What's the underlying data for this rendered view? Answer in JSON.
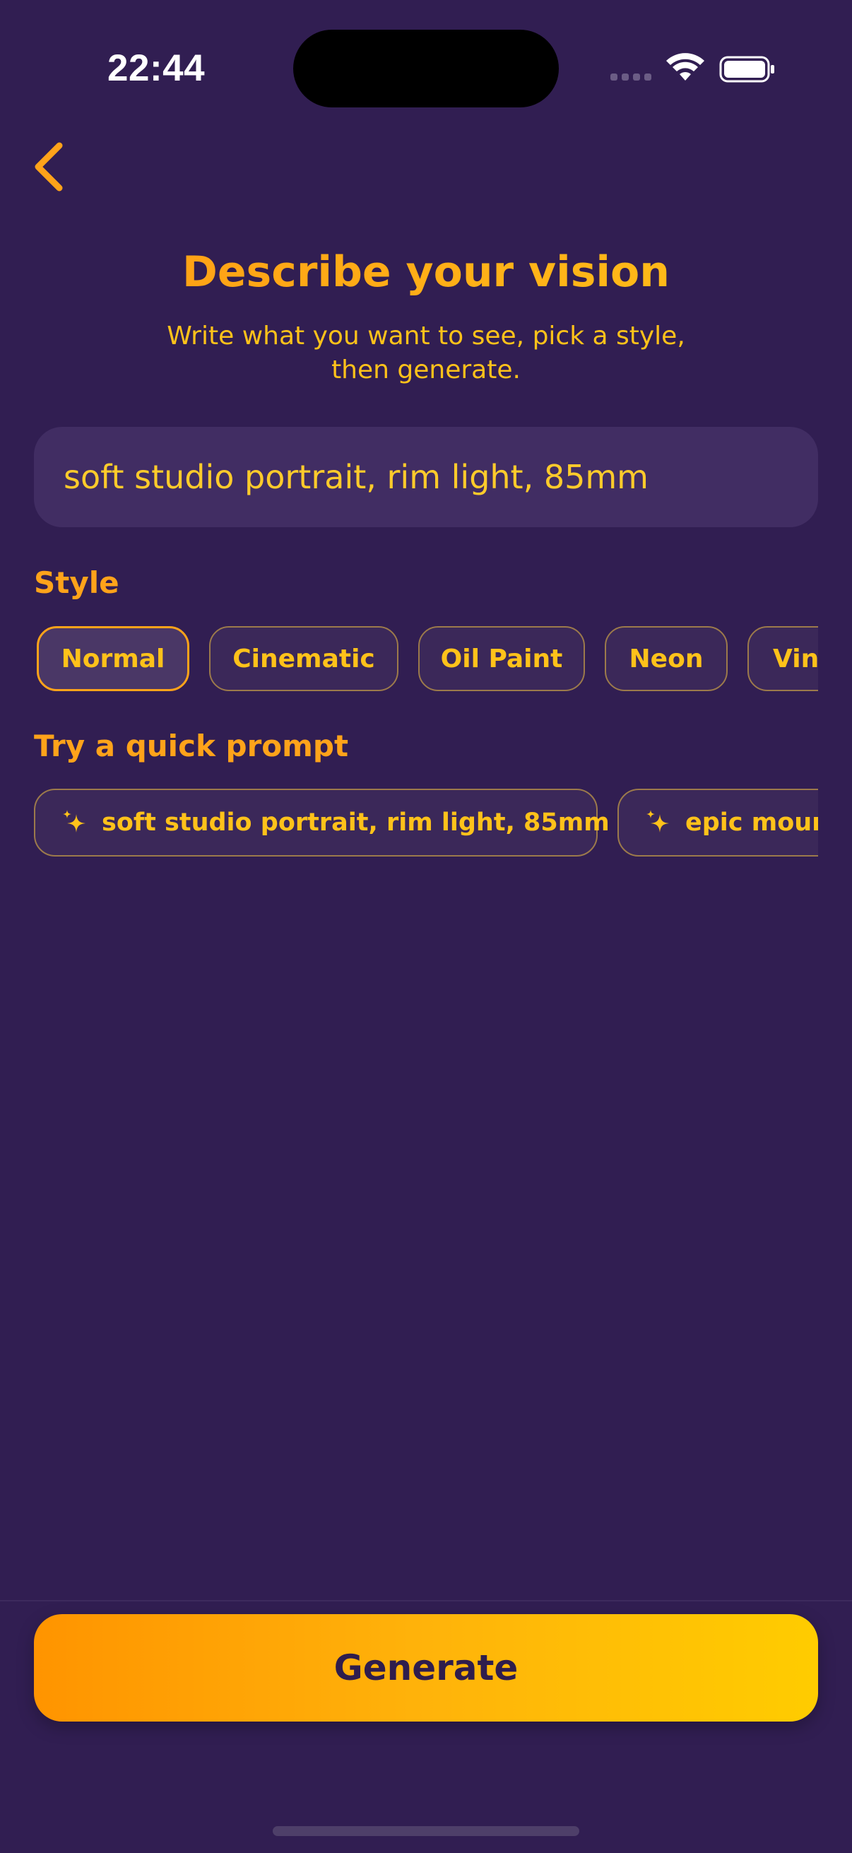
{
  "status_bar": {
    "time": "22:44"
  },
  "header": {
    "title": "Describe your vision",
    "subtitle_line1": "Write what you want to see, pick a style,",
    "subtitle_line2": "then generate."
  },
  "prompt_input": {
    "value": "soft studio portrait, rim light, 85mm"
  },
  "style_section": {
    "label": "Style",
    "selected": "Normal",
    "chips": [
      "Normal",
      "Cinematic",
      "Oil Paint",
      "Neon",
      "Vin"
    ]
  },
  "quick_prompt_section": {
    "label": "Try a quick prompt",
    "chips": [
      "soft studio portrait, rim light, 85mm",
      "epic mour"
    ]
  },
  "footer": {
    "generate_label": "Generate"
  },
  "colors": {
    "background": "#311e52",
    "accent_orange": "#ffa31a",
    "accent_yellow": "#ffc21a",
    "chip_border": "#9c7a4b",
    "button_text": "#2f1d4d"
  },
  "icons": {
    "back": "chevron-left-icon",
    "sparkle": "sparkle-icon",
    "wifi": "wifi-icon",
    "battery": "battery-icon",
    "signal": "cellular-signal-icon"
  }
}
